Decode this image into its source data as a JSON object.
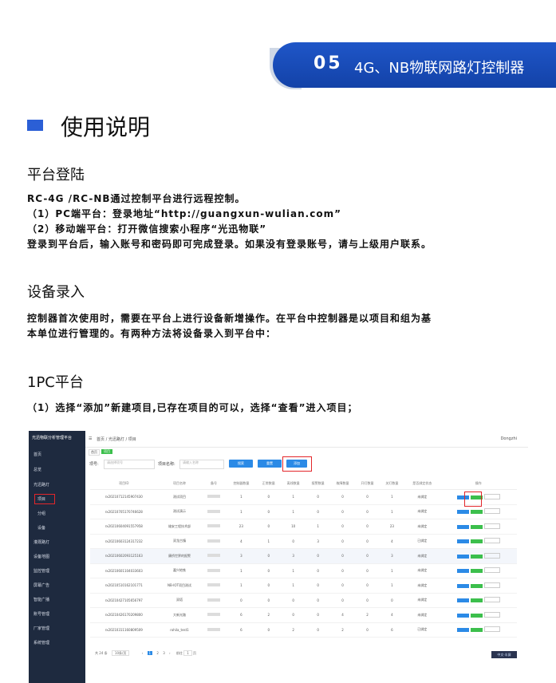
{
  "header": {
    "number": "05",
    "title": "4G、NB物联网路灯控制器"
  },
  "section_title": "使用说明",
  "login": {
    "heading": "平台登陆",
    "lines": [
      "RC-4G /RC-NB通过控制平台进行远程控制。",
      "（1）PC端平台：登录地址“http://guangxun-wulian.com”",
      "（2）移动端平台：打开微信搜索小程序“光迅物联”",
      "登录到平台后，输入账号和密码即可完成登录。如果没有登录账号，请与上级用户联系。"
    ]
  },
  "device": {
    "heading": "设备录入",
    "lines": [
      "控制器首次使用时，需要在平台上进行设备新增操作。在平台中控制器是以项目和组为基",
      "本单位进行管理的。有两种方法将设备录入到平台中："
    ]
  },
  "pc": {
    "heading": "1PC平台",
    "line": "（1）选择“添加”新建项目,已存在项目的可以，选择“查看”进入项目；"
  },
  "screenshot": {
    "app_name": "光迅物联分析管理平台",
    "sidebar": [
      "首页",
      "总览",
      "光迅路灯",
      "项目",
      "分组",
      "设备",
      "灌溉路灯",
      "设备地图",
      "监控管理",
      "屏幕广告",
      "智能广播",
      "账号管理",
      "厂家管理",
      "系统管理"
    ],
    "breadcrumb": "首页 / 光迅路灯 / 项目",
    "tabs": [
      "首页",
      "项目"
    ],
    "user": "Dongzhi",
    "filter_label_1": "项号:",
    "filter_placeholder_1": "请选择项号",
    "filter_label_2": "项目名称:",
    "filter_placeholder_2": "请输入名称",
    "btn_search": "搜索",
    "btn_reset": "重置",
    "btn_add": "添加",
    "columns": [
      "项目ID",
      "项目名称",
      "备号",
      "控制器数量",
      "正常数量",
      "离线数量",
      "报警数量",
      "故障数量",
      "开灯数量",
      "关灯数量",
      "是否绑定状态",
      "操作"
    ],
    "rows": [
      [
        "rx20210712145907430",
        "测试项目",
        "",
        "1",
        "0",
        "1",
        "0",
        "0",
        "0",
        "1",
        "未绑定"
      ],
      [
        "rx20210705170746628",
        "测试演示",
        "",
        "1",
        "0",
        "1",
        "0",
        "0",
        "0",
        "1",
        "未绑定"
      ],
      [
        "rx20210604091557958",
        "雄安工程技术部",
        "",
        "23",
        "0",
        "10",
        "1",
        "0",
        "0",
        "23",
        "未绑定"
      ],
      [
        "rx20210603124317232",
        "双龙古镇",
        "",
        "4",
        "1",
        "0",
        "3",
        "0",
        "0",
        "4",
        "已绑定"
      ],
      [
        "rx20210602093125163",
        "康桥世界的报警",
        "",
        "3",
        "0",
        "3",
        "0",
        "0",
        "0",
        "3",
        "未绑定"
      ],
      [
        "rx20210601104033603",
        "嘉兴地铁",
        "",
        "1",
        "0",
        "1",
        "0",
        "0",
        "0",
        "1",
        "未绑定"
      ],
      [
        "rx20210510162101771",
        "NB-IOT项目测试",
        "",
        "1",
        "0",
        "1",
        "0",
        "0",
        "0",
        "1",
        "未绑定"
      ],
      [
        "rx20210427105656797",
        "双塔",
        "",
        "0",
        "0",
        "0",
        "0",
        "0",
        "0",
        "0",
        "未绑定"
      ],
      [
        "rx20210426170209800",
        "大新光路",
        "",
        "6",
        "2",
        "0",
        "0",
        "4",
        "2",
        "4",
        "未绑定"
      ],
      [
        "rx20210311160809509",
        "rohila_test1",
        "",
        "6",
        "0",
        "2",
        "0",
        "2",
        "0",
        "6",
        "已绑定"
      ]
    ],
    "row_actions": [
      "查看",
      "编辑",
      "更多"
    ],
    "pager": {
      "total": "共 24 条",
      "per_page": "10条/页",
      "pages": [
        "1",
        "2",
        "3"
      ],
      "goto": "前往",
      "page_num": "1",
      "page_unit": "页"
    },
    "watermark": "中文·半屏"
  },
  "colors": {
    "accent": "#1f56c8",
    "highlight": "#e3262a"
  }
}
